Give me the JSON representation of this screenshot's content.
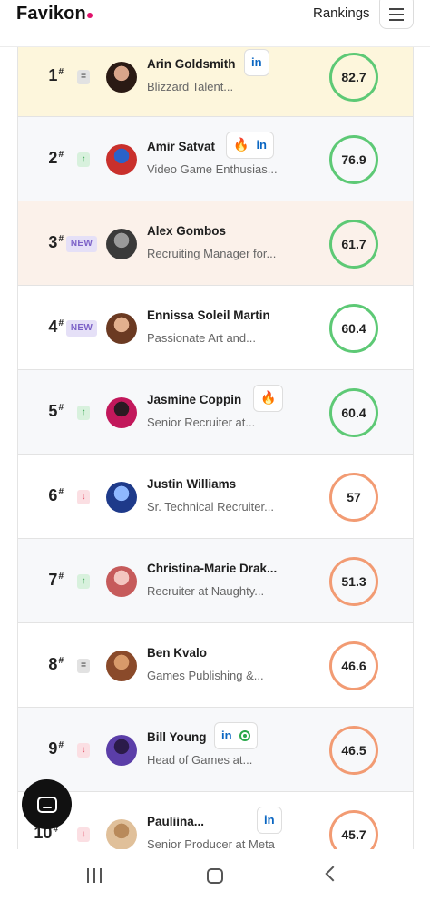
{
  "header": {
    "logo": "Favikon",
    "nav_label": "Rankings",
    "menu_icon": "hamburger-menu-icon"
  },
  "colors": {
    "green_ring": "#5dc975",
    "orange_ring": "#f29b73",
    "row_highlight_gold": "#fdf6dc",
    "row_highlight_peach": "#fbf1ea",
    "row_alt": "#f7f8fa"
  },
  "rankings": [
    {
      "rank": "1",
      "change": "eq",
      "change_label": "=",
      "name": "Arin Goldsmith",
      "title": "Blizzard Talent...",
      "icons": [
        "in"
      ],
      "score": "82.7",
      "score_color": "green"
    },
    {
      "rank": "2",
      "change": "up",
      "change_label": "↑",
      "name": "Amir Satvat",
      "title": "Video Game Enthusias...",
      "icons": [
        "fire",
        "in"
      ],
      "score": "76.9",
      "score_color": "green"
    },
    {
      "rank": "3",
      "change": "new",
      "change_label": "NEW",
      "name": "Alex Gombos",
      "title": "Recruiting Manager for...",
      "icons": [],
      "score": "61.7",
      "score_color": "green"
    },
    {
      "rank": "4",
      "change": "new",
      "change_label": "NEW",
      "name": "Ennissa Soleil Martin",
      "title": "Passionate Art and...",
      "icons": [],
      "score": "60.4",
      "score_color": "green"
    },
    {
      "rank": "5",
      "change": "up",
      "change_label": "↑",
      "name": "Jasmine Coppin",
      "title": "Senior Recruiter at...",
      "icons": [
        "fire"
      ],
      "score": "60.4",
      "score_color": "green"
    },
    {
      "rank": "6",
      "change": "down",
      "change_label": "↓",
      "name": "Justin Williams",
      "title": "Sr. Technical Recruiter...",
      "icons": [],
      "score": "57",
      "score_color": "orange"
    },
    {
      "rank": "7",
      "change": "up",
      "change_label": "↑",
      "name": "Christina-Marie Drak...",
      "title": "Recruiter at Naughty...",
      "icons": [],
      "score": "51.3",
      "score_color": "orange"
    },
    {
      "rank": "8",
      "change": "eq",
      "change_label": "=",
      "name": "Ben Kvalo",
      "title": "Games Publishing &...",
      "icons": [],
      "score": "46.6",
      "score_color": "orange"
    },
    {
      "rank": "9",
      "change": "down",
      "change_label": "↓",
      "name": "Bill Young",
      "title": "Head of Games at...",
      "icons": [
        "in",
        "podcast"
      ],
      "score": "46.5",
      "score_color": "orange"
    },
    {
      "rank": "10",
      "change": "down",
      "change_label": "↓",
      "name": "Pauliina...",
      "title": "Senior Producer at Meta",
      "icons": [
        "in"
      ],
      "score": "45.7",
      "score_color": "orange"
    }
  ],
  "rank_suffix": "#",
  "linkedin_label": "in",
  "fire_glyph": "🔥",
  "chat_icon": "chat-bubble-icon",
  "system_nav": {
    "recent_icon": "recent-apps-icon",
    "home_icon": "home-icon",
    "back_icon": "back-icon"
  }
}
